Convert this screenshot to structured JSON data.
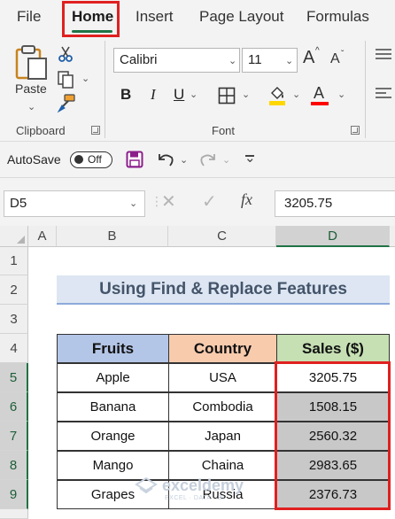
{
  "menu": {
    "file": "File",
    "home": "Home",
    "insert": "Insert",
    "page_layout": "Page Layout",
    "formulas": "Formulas"
  },
  "ribbon": {
    "clipboard": {
      "paste_label": "Paste",
      "group_label": "Clipboard"
    },
    "font": {
      "font_name": "Calibri",
      "font_size": "11",
      "group_label": "Font",
      "bold_glyph": "B",
      "italic_glyph": "I",
      "underline_glyph": "U",
      "grow_glyph": "A",
      "shrink_glyph": "A",
      "font_color_glyph": "A",
      "font_color": "#ff0000",
      "fill_color": "#ffd700"
    }
  },
  "qat": {
    "autosave_label": "AutoSave",
    "autosave_state": "Off"
  },
  "formula_bar": {
    "name_box": "D5",
    "fx_label": "fx",
    "value": "3205.75"
  },
  "sheet": {
    "columns": [
      "A",
      "B",
      "C",
      "D"
    ],
    "rows": [
      "1",
      "2",
      "3",
      "4",
      "5",
      "6",
      "7",
      "8",
      "9"
    ],
    "selected_column": "D",
    "selected_row": "5",
    "title": "Using Find & Replace Features",
    "table": {
      "headers": [
        "Fruits",
        "Country",
        "Sales ($)"
      ],
      "header_colors": [
        "#b4c6e7",
        "#f8cbad",
        "#c6e0b4"
      ],
      "rows": [
        [
          "Apple",
          "USA",
          "3205.75"
        ],
        [
          "Banana",
          "Combodia",
          "1508.15"
        ],
        [
          "Orange",
          "Japan",
          "2560.32"
        ],
        [
          "Mango",
          "Chaina",
          "2983.65"
        ],
        [
          "Grapes",
          "Russia",
          "2376.73"
        ]
      ],
      "selection_fill": "#c8c8c8"
    }
  },
  "watermark": {
    "name": "exceldemy",
    "sub": "EXCEL · DATA · BI"
  }
}
